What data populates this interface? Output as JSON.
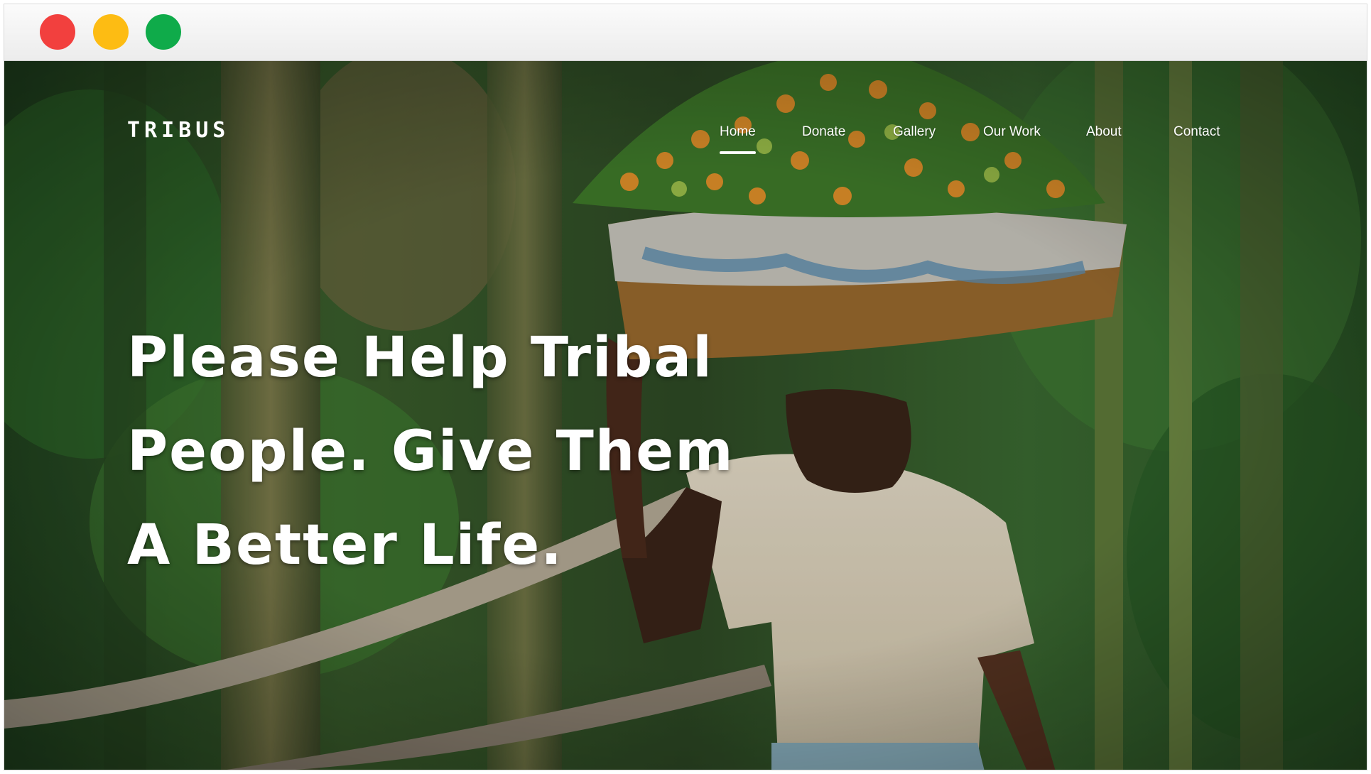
{
  "window": {
    "controls": {
      "close_color": "#f2403e",
      "minimize_color": "#fdbc13",
      "maximize_color": "#0fab4a"
    }
  },
  "site": {
    "logo": "TRIBUS",
    "nav": [
      {
        "label": "Home",
        "active": true
      },
      {
        "label": "Donate",
        "active": false
      },
      {
        "label": "Gallery",
        "active": false
      },
      {
        "label": "Our Work",
        "active": false
      },
      {
        "label": "About",
        "active": false
      },
      {
        "label": "Contact",
        "active": false
      }
    ]
  },
  "hero": {
    "headline_lines": [
      "Please Help Tribal",
      "People. Give Them",
      "A Better Life."
    ],
    "background": "photo-tribal-man-carrying-fruit-basket"
  }
}
